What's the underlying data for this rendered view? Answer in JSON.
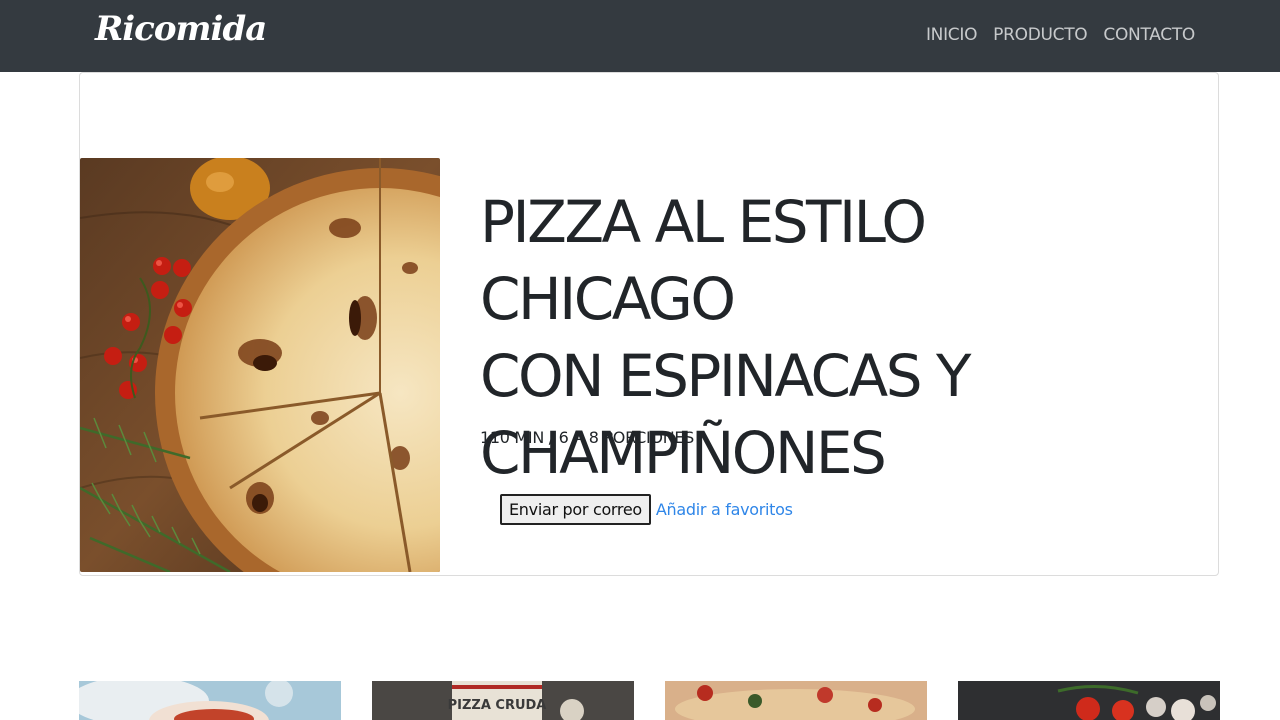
{
  "navbar": {
    "brand": "Ricomida",
    "links": [
      "INICIO",
      "PRODUCTO",
      "CONTACTO"
    ]
  },
  "recipe": {
    "image_subject": "pizza-photo",
    "title_lines": [
      "PIZZA AL ESTILO CHICAGO",
      "CON ESPINACAS Y",
      "CHAMPIÑONES"
    ],
    "meta": "110 MIN / 6 A 8 PORCIONES",
    "email_button": "Enviar por correo",
    "favorite_link": "Añadir a favoritos"
  },
  "thumbnails": {
    "second_label": "PIZZA CRUDA"
  },
  "colors": {
    "navbar_bg": "#343a40",
    "link_blue": "#2f86e8",
    "nav_text": "#c7c9cb"
  }
}
